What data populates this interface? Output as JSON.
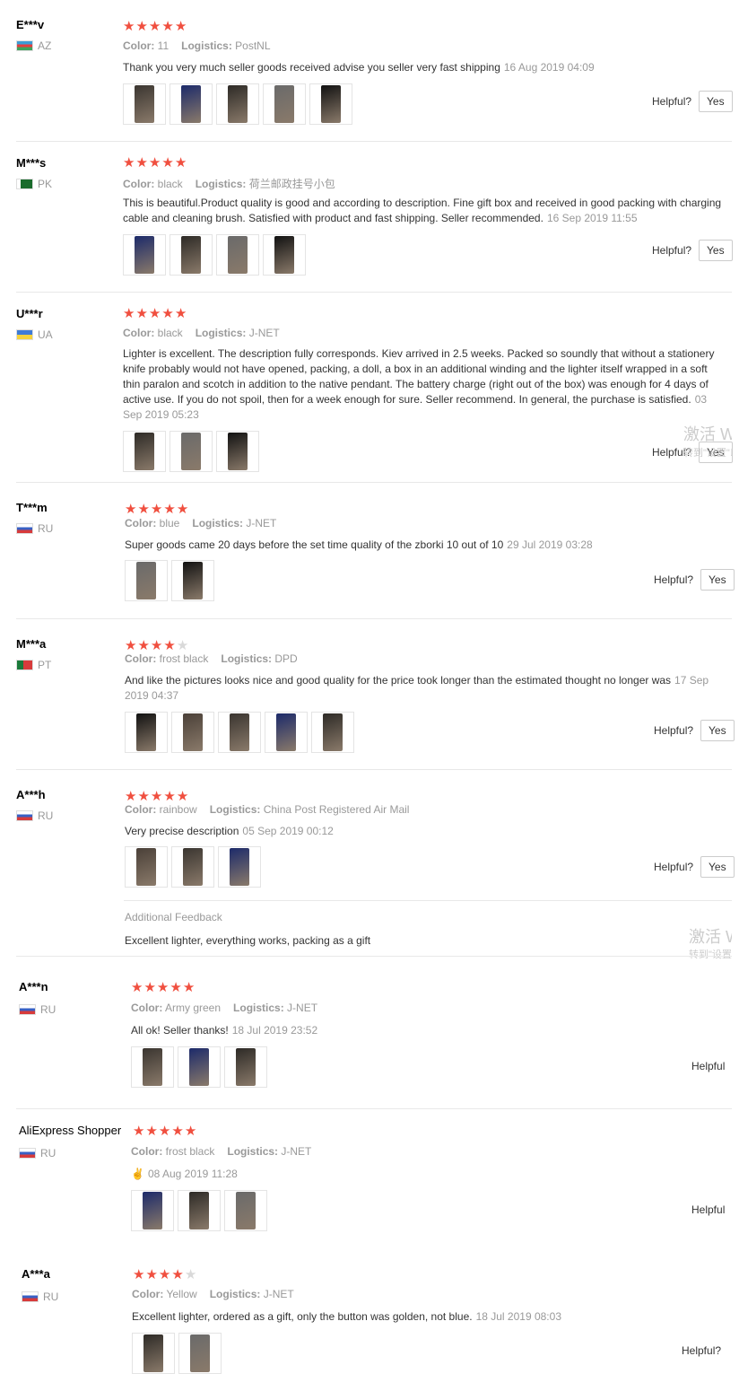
{
  "colors": {
    "star_on": "#f04f3f",
    "star_off": "#d9d9d9",
    "meta": "#999999"
  },
  "labels": {
    "color": "Color:",
    "logistics": "Logistics:",
    "helpful": "Helpful?",
    "yes": "Yes",
    "additional_feedback": "Additional Feedback",
    "watermark_main": "激活 Windows",
    "watermark_sub": "转到\"设置\"以激活 Windows。"
  },
  "reviews": [
    {
      "user": "E***v",
      "country": "AZ",
      "rating": 5,
      "color": "11",
      "logistics": "PostNL",
      "text": "Thank you very much seller goods received advise you seller very fast shipping",
      "date": "16 Aug 2019 04:09",
      "photos": 5,
      "helpful": "Helpful?",
      "yes": "Yes"
    },
    {
      "user": "M***s",
      "country": "PK",
      "rating": 5,
      "color": "black",
      "logistics": "荷兰邮政挂号小包",
      "text": "This is beautiful.Product quality is good and according to description. Fine gift box and received in good packing with charging cable and cleaning brush. Satisfied with product and fast shipping. Seller recommended.",
      "date": "16 Sep 2019 11:55",
      "photos": 4,
      "helpful": "Helpful?",
      "yes": "Yes"
    },
    {
      "user": "U***r",
      "country": "UA",
      "rating": 5,
      "color": "black",
      "logistics": "J-NET",
      "text": "Lighter is excellent. The description fully corresponds. Kiev arrived in 2.5 weeks. Packed so soundly that without a stationery knife probably would not have opened, packing, a doll, a box in an additional winding and the lighter itself wrapped in a soft thin paralon and scotch in addition to the native pendant. The battery charge (right out of the box) was enough for 4 days of active use. If you do not spoil, then for a week enough for sure. Seller recommend. In general, the purchase is satisfied.",
      "date": "03 Sep 2019 05:23",
      "photos": 3,
      "helpful": "Helpful?",
      "yes": "Yes"
    },
    {
      "user": "T***m",
      "country": "RU",
      "rating": 5,
      "color": "blue",
      "logistics": "J-NET",
      "text": "Super goods came 20 days before the set time quality of the zborki 10 out of 10",
      "date": "29 Jul 2019 03:28",
      "photos": 2,
      "helpful": "Helpful?",
      "yes": "Yes"
    },
    {
      "user": "M***a",
      "country": "PT",
      "rating": 4,
      "color": "frost black",
      "logistics": "DPD",
      "text": "And like the pictures looks nice and good quality for the price took longer than the estimated thought no longer was",
      "date": "17 Sep 2019 04:37",
      "photos": 5,
      "helpful": "Helpful?",
      "yes": "Yes"
    },
    {
      "user": "A***h",
      "country": "RU",
      "rating": 5,
      "color": "rainbow",
      "logistics": "China Post Registered Air Mail",
      "text": "Very precise description",
      "date": "05 Sep 2019 00:12",
      "photos": 3,
      "helpful": "Helpful?",
      "yes": "Yes",
      "additional": "Excellent lighter, everything works, packing as a gift"
    },
    {
      "user": "A***n",
      "country": "RU",
      "rating": 5,
      "color": "Army green",
      "logistics": "J-NET",
      "text": "All ok! Seller thanks!",
      "date": "18 Jul 2019 23:52",
      "photos": 3,
      "helpful": "Helpful"
    },
    {
      "user": "AliExpress Shopper",
      "country": "RU",
      "rating": 5,
      "color": "frost black",
      "logistics": "J-NET",
      "text": "✌",
      "date": "08 Aug 2019 11:28",
      "photos": 3,
      "helpful": "Helpful"
    },
    {
      "user": "A***a",
      "country": "RU",
      "rating": 4,
      "color": "Yellow",
      "logistics": "J-NET",
      "text": "Excellent lighter, ordered as a gift, only the button was golden, not blue.",
      "date": "18 Jul 2019 08:03",
      "photos": 2,
      "helpful": "Helpful?"
    }
  ]
}
